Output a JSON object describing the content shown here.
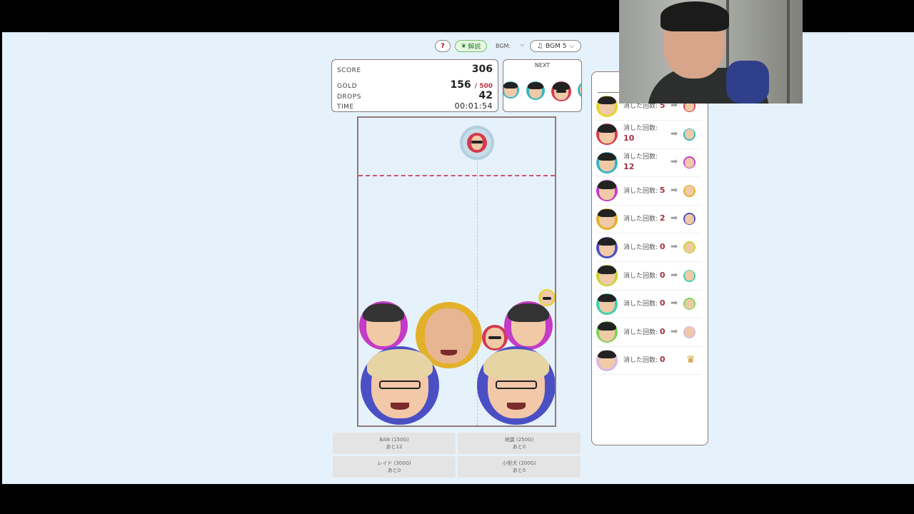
{
  "toolbar": {
    "help_label": "?",
    "explain_label": "解説",
    "bgm_label": "BGM: ",
    "bgm_select": "BGM 5"
  },
  "score": {
    "score_label": "SCORE",
    "score_value": "306",
    "gold_label": "GOLD",
    "gold_value": "156",
    "gold_max": "/ 500",
    "drops_label": "DROPS",
    "drops_value": "42",
    "time_label": "TIME",
    "time_value": "00:01:54"
  },
  "next": {
    "label": "NEXT"
  },
  "abilities": [
    {
      "name": "BAN (150G)",
      "remaining": "あと12"
    },
    {
      "name": "地震 (250G)",
      "remaining": "あと0"
    },
    {
      "name": "レイド (300G)",
      "remaining": "あと0"
    },
    {
      "name": "小型犬 (200G)",
      "remaining": "あと0"
    }
  ],
  "side": {
    "count_label": "消した回数:",
    "rows": [
      {
        "count": "5",
        "ring": "#e6d52a"
      },
      {
        "count": "10",
        "ring": "#d33a4e"
      },
      {
        "count": "12",
        "ring": "#35b6c4"
      },
      {
        "count": "5",
        "ring": "#c53ac7"
      },
      {
        "count": "2",
        "ring": "#e3b129"
      },
      {
        "count": "0",
        "ring": "#4b4fc4"
      },
      {
        "count": "0",
        "ring": "#c7d42a"
      },
      {
        "count": "0",
        "ring": "#3fcfb4"
      },
      {
        "count": "0",
        "ring": "#7dd45a"
      },
      {
        "count": "0",
        "ring": "#d9b7e6"
      }
    ]
  },
  "colors": {
    "accent_red": "#b3343f",
    "field_bg": "#e6f2fb"
  }
}
